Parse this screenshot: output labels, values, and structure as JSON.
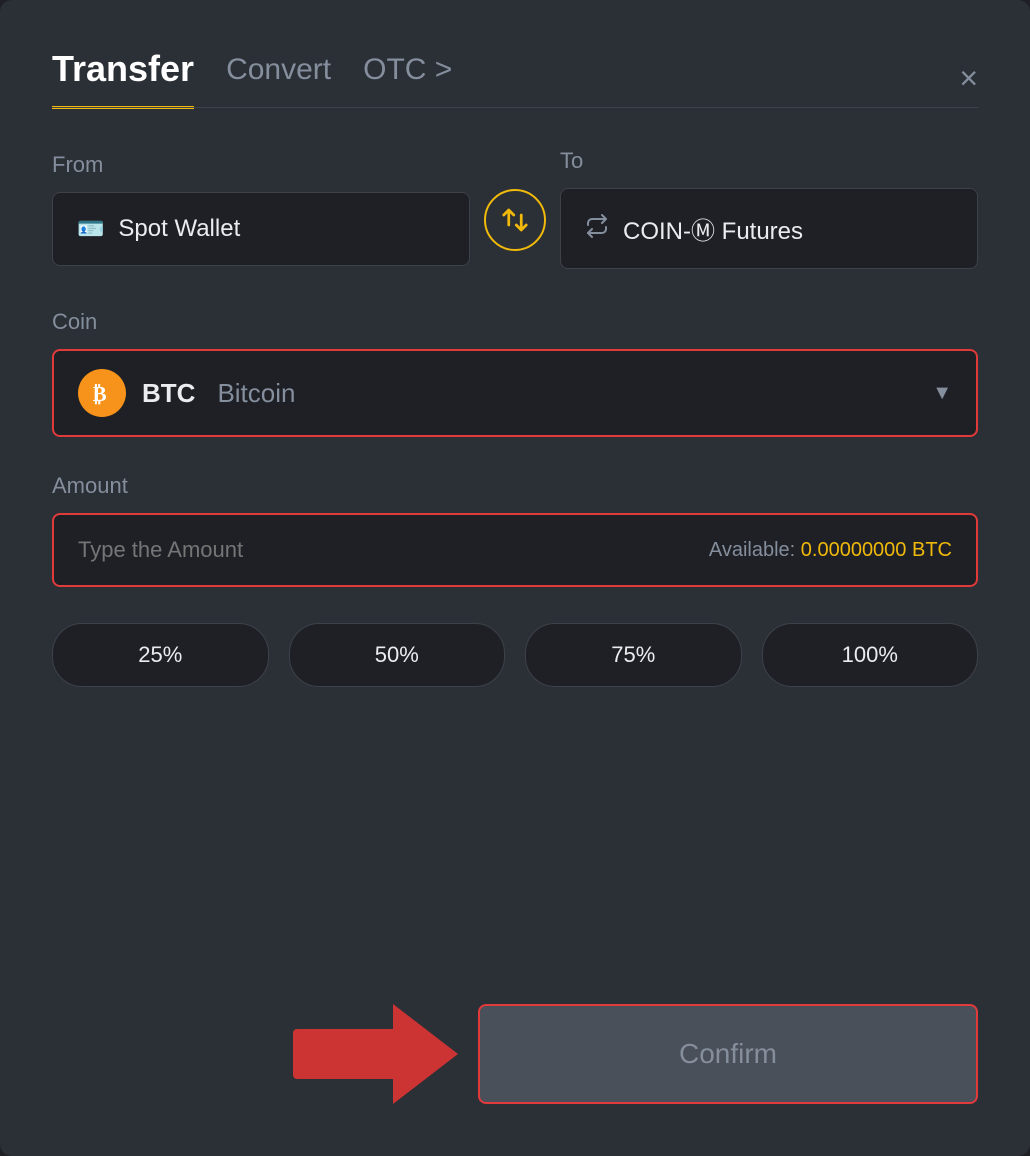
{
  "modal": {
    "tabs": [
      {
        "id": "transfer",
        "label": "Transfer",
        "active": true
      },
      {
        "id": "convert",
        "label": "Convert",
        "active": false
      },
      {
        "id": "otc",
        "label": "OTC >",
        "active": false
      }
    ],
    "close_label": "×",
    "from_label": "From",
    "to_label": "To",
    "from_wallet": "Spot Wallet",
    "to_wallet": "COIN-Ⓜ Futures",
    "swap_icon": "⇄",
    "coin_label": "Coin",
    "coin_symbol": "BTC",
    "coin_name": "Bitcoin",
    "amount_label": "Amount",
    "amount_placeholder": "Type the Amount",
    "available_label": "Available:",
    "available_value": "0.00000000 BTC",
    "percent_buttons": [
      "25%",
      "50%",
      "75%",
      "100%"
    ],
    "confirm_label": "Confirm"
  }
}
